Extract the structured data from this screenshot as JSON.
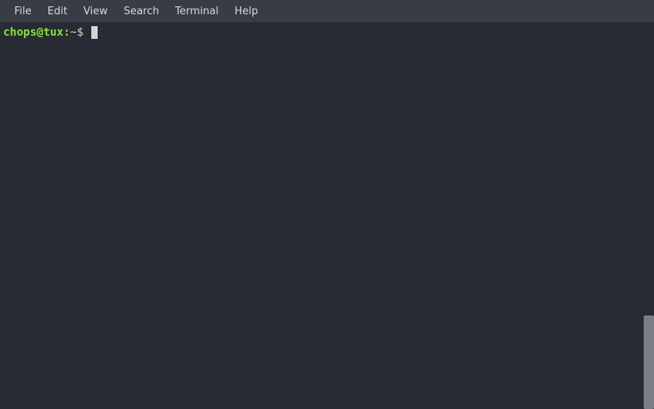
{
  "menubar": {
    "items": [
      {
        "label": "File"
      },
      {
        "label": "Edit"
      },
      {
        "label": "View"
      },
      {
        "label": "Search"
      },
      {
        "label": "Terminal"
      },
      {
        "label": "Help"
      }
    ]
  },
  "terminal": {
    "prompt": {
      "user_host": "chops@tux",
      "colon": ":",
      "path": "~",
      "symbol": "$ "
    }
  }
}
